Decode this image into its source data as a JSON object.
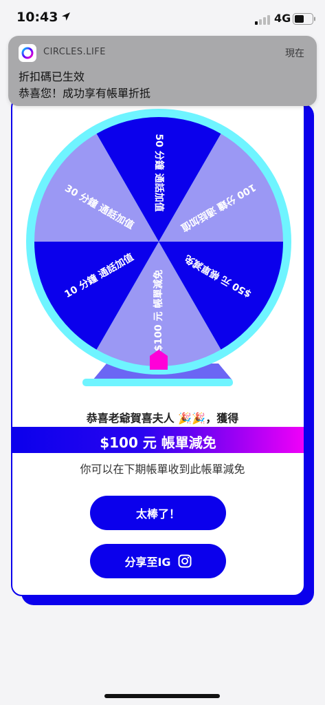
{
  "status_bar": {
    "time": "10:43",
    "network": "4G"
  },
  "notification": {
    "app_name": "CIRCLES.LIFE",
    "time": "現在",
    "title": "折扣碼已生效",
    "body": "恭喜您！成功享有帳單折抵"
  },
  "wheel": {
    "segments": [
      {
        "label": "50 分鐘 通話加值",
        "color": "#0b00ec"
      },
      {
        "label": "100 分鐘 通話加值",
        "color": "#9b98f4"
      },
      {
        "label": "$50 元 帳單減免",
        "color": "#0b00ec"
      },
      {
        "label": "$100 元 帳單減免",
        "color": "#9b98f4"
      },
      {
        "label": "10 分鐘 通話加值",
        "color": "#0b00ec"
      },
      {
        "label": "30 分鐘 通話加值",
        "color": "#9b98f4"
      }
    ],
    "rim_color": "#6ff4ff",
    "pointer_color": "#ff00d8",
    "stand_color": "#6b66f4"
  },
  "result": {
    "winner_line": "恭喜老爺賀喜夫人 🎉🎉，獲得",
    "prize": "$100 元 帳單減免",
    "subtitle": "你可以在下期帳單收到此帳單減免"
  },
  "buttons": {
    "great": "太棒了！",
    "share": "分享至IG"
  },
  "icons": {
    "location": "location-arrow-icon",
    "signal": "cellular-signal-icon",
    "battery": "battery-icon",
    "app": "circles-life-logo-icon",
    "instagram": "instagram-icon"
  }
}
